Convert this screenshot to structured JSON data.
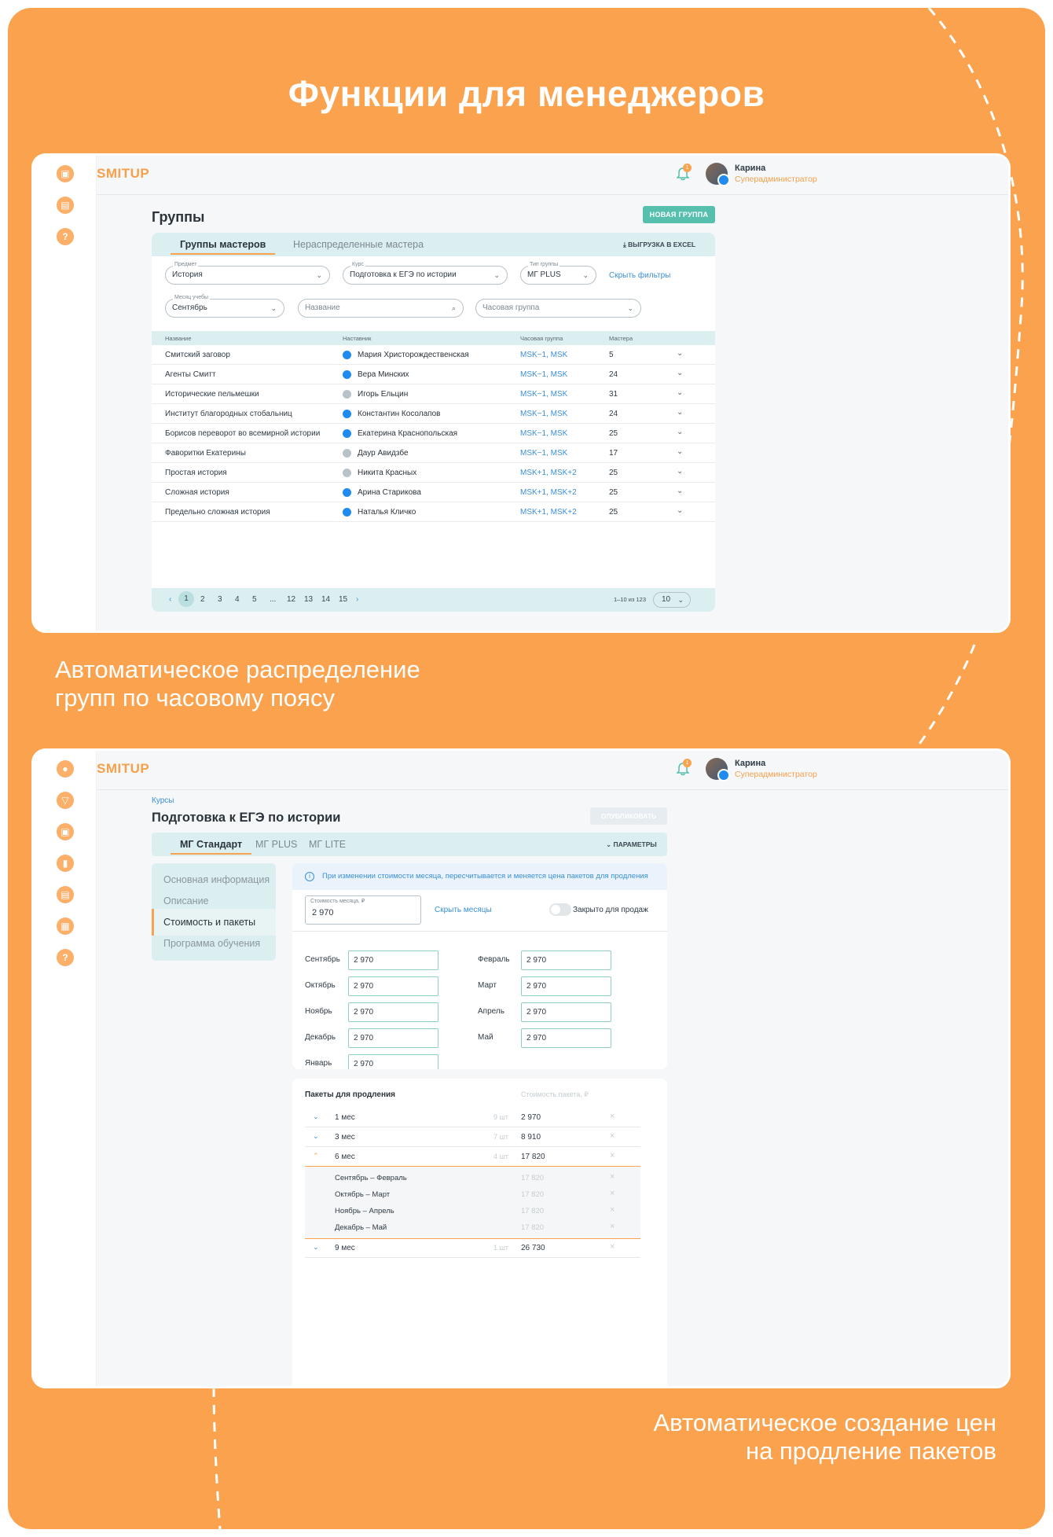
{
  "poster": {
    "title": "Функции для менеджеров",
    "caption1_line1": "Автоматическое распределение",
    "caption1_line2": "групп по часовому поясу",
    "caption2_line1": "Автоматическое создание цен",
    "caption2_line2": "на продление пакетов",
    "accent": "#fba24e"
  },
  "app": {
    "logo": "SMITUP",
    "notification_count": "1",
    "user_name": "Карина",
    "user_role": "Суперадминистратор"
  },
  "groups_screen": {
    "title": "Группы",
    "new_group_button": "НОВАЯ ГРУППА",
    "tabs": [
      "Группы мастеров",
      "Нераспределенные мастера"
    ],
    "export_button": "ВЫГРУЗКА В EXCEL",
    "filters": {
      "subject_label": "Предмет",
      "subject_value": "История",
      "course_label": "Курс",
      "course_value": "Подготовка к ЕГЭ по истории",
      "group_type_label": "Тип группы",
      "group_type_value": "МГ PLUS",
      "hide_filters": "Скрыть фильтры",
      "month_label": "Месяц учебы",
      "month_value": "Сентябрь",
      "name_placeholder": "Название",
      "hour_group_placeholder": "Часовая группа"
    },
    "columns": [
      "Название",
      "Наставник",
      "Часовая группа",
      "Мастера"
    ],
    "rows": [
      {
        "name": "Смитский заговор",
        "mentor": "Мария Христорождественская",
        "vk": true,
        "tz": "MSK−1, MSK",
        "masters": "5"
      },
      {
        "name": "Агенты Смитт",
        "mentor": "Вера Минских",
        "vk": true,
        "tz": "MSK−1, MSK",
        "masters": "24"
      },
      {
        "name": "Исторические пельмешки",
        "mentor": "Игорь Ельцин",
        "vk": false,
        "tz": "MSK−1, MSK",
        "masters": "31"
      },
      {
        "name": "Институт благородных стобальниц",
        "mentor": "Константин Косолапов",
        "vk": true,
        "tz": "MSK−1, MSK",
        "masters": "24"
      },
      {
        "name": "Борисов переворот во всемирной истории",
        "mentor": "Екатерина Краснопольская",
        "vk": true,
        "tz": "MSK−1, MSK",
        "masters": "25"
      },
      {
        "name": "Фаворитки Екатерины",
        "mentor": "Даур Авидзбе",
        "vk": false,
        "tz": "MSK−1, MSK",
        "masters": "17"
      },
      {
        "name": "Простая история",
        "mentor": "Никита Красных",
        "vk": false,
        "tz": "MSK+1, MSK+2",
        "masters": "25"
      },
      {
        "name": "Сложная история",
        "mentor": "Арина Старикова",
        "vk": true,
        "tz": "MSK+1, MSK+2",
        "masters": "25"
      },
      {
        "name": "Предельно сложная история",
        "mentor": "Наталья Кличко",
        "vk": true,
        "tz": "MSK+1, MSK+2",
        "masters": "25"
      }
    ],
    "pagination": {
      "prev": "‹",
      "next": "›",
      "pages": [
        "1",
        "2",
        "3",
        "4",
        "5",
        "...",
        "12",
        "13",
        "14",
        "15"
      ],
      "current": "1",
      "total": "1–10 из 123",
      "per_page": "10"
    }
  },
  "course_screen": {
    "breadcrumb": "Курсы",
    "title": "Подготовка к ЕГЭ по истории",
    "publish_button": "ОПУБЛИКОВАТЬ",
    "tabs": [
      "МГ Стандарт",
      "МГ PLUS",
      "МГ LITE"
    ],
    "params_button": "ПАРАМЕТРЫ",
    "sidenav": [
      "Основная информация",
      "Описание",
      "Стоимость и пакеты",
      "Программа обучения"
    ],
    "sidenav_active": 2,
    "notice": "При изменении стоимости месяца, пересчитывается и меняется цена пакетов для продления",
    "month_price_label": "Стоимость месяца, ₽",
    "month_price_value": "2 970",
    "hide_months": "Скрыть месяцы",
    "closed_for_sale": "Закрыто для продаж",
    "months_left": [
      {
        "label": "Сентябрь",
        "value": "2 970"
      },
      {
        "label": "Октябрь",
        "value": "2 970"
      },
      {
        "label": "Ноябрь",
        "value": "2 970"
      },
      {
        "label": "Декабрь",
        "value": "2 970"
      },
      {
        "label": "Январь",
        "value": "2 970"
      }
    ],
    "months_right": [
      {
        "label": "Февраль",
        "value": "2 970"
      },
      {
        "label": "Март",
        "value": "2 970"
      },
      {
        "label": "Апрель",
        "value": "2 970"
      },
      {
        "label": "Май",
        "value": "2 970"
      }
    ],
    "packages_title": "Пакеты для продления",
    "packages_price_head": "Стоимость пакета, ₽",
    "packages": [
      {
        "name": "1 мес",
        "count": "9 шт",
        "price": "2 970"
      },
      {
        "name": "3 мес",
        "count": "7 шт",
        "price": "8 910"
      },
      {
        "name": "6 мес",
        "count": "4 шт",
        "price": "17 820"
      }
    ],
    "package_open_items": [
      {
        "name": "Сентябрь – Февраль",
        "price": "17 820"
      },
      {
        "name": "Октябрь – Март",
        "price": "17 820"
      },
      {
        "name": "Ноябрь – Апрель",
        "price": "17 820"
      },
      {
        "name": "Декабрь – Май",
        "price": "17 820"
      }
    ],
    "package_last": {
      "name": "9 мес",
      "count": "1 шт",
      "price": "26 730"
    }
  }
}
